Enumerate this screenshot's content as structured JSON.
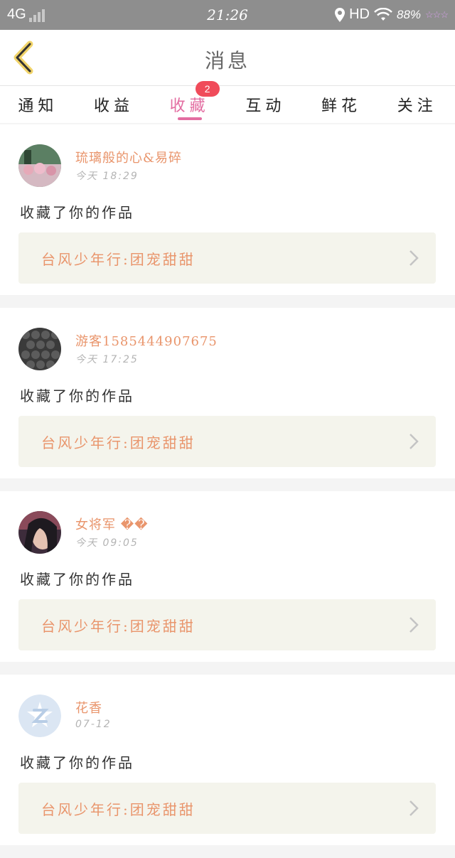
{
  "status_bar": {
    "network": "4G",
    "time": "21:26",
    "hd": "HD",
    "battery": "88%"
  },
  "header": {
    "title": "消息",
    "back_icon": "chevron-left-icon"
  },
  "tabs": [
    {
      "label": "通知",
      "active": false
    },
    {
      "label": "收益",
      "active": false
    },
    {
      "label": "收藏",
      "active": true,
      "badge": "2"
    },
    {
      "label": "互动",
      "active": false
    },
    {
      "label": "鲜花",
      "active": false
    },
    {
      "label": "关注",
      "active": false
    }
  ],
  "colors": {
    "accent": "#e36da1",
    "name": "#e9956c",
    "badge": "#f04b5a"
  },
  "messages": [
    {
      "name": "琉璃般的心&易碎",
      "time": "今天 18:29",
      "action": "收藏了你的作品",
      "work": "台风少年行:团宠甜甜"
    },
    {
      "name": "游客1585444907675",
      "time": "今天 17:25",
      "action": "收藏了你的作品",
      "work": "台风少年行:团宠甜甜"
    },
    {
      "name": "女将军 ��",
      "time": "今天 09:05",
      "action": "收藏了你的作品",
      "work": "台风少年行:团宠甜甜"
    },
    {
      "name": "花香",
      "time": "07-12",
      "action": "收藏了你的作品",
      "work": "台风少年行:团宠甜甜"
    }
  ]
}
